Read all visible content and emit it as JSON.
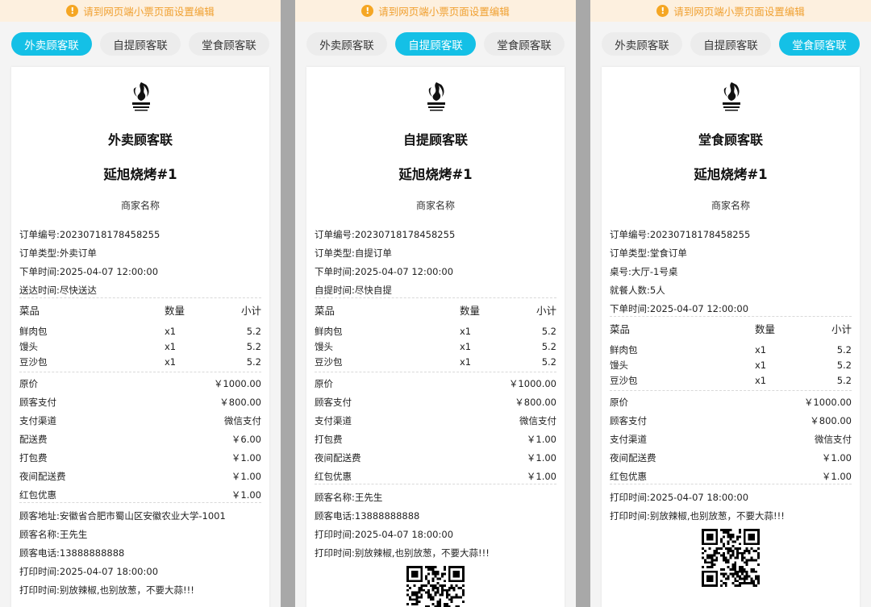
{
  "banner": "请到网页端小票页面设置编辑",
  "tabs": [
    "外卖顾客联",
    "自提顾客联",
    "堂食顾客联"
  ],
  "columns": {
    "item": "菜品",
    "qty": "数量",
    "subtotal": "小计"
  },
  "items": [
    {
      "name": "鲜肉包",
      "qty": "x1",
      "price": "5.2"
    },
    {
      "name": "馒头",
      "qty": "x1",
      "price": "5.2"
    },
    {
      "name": "豆沙包",
      "qty": "x1",
      "price": "5.2"
    }
  ],
  "receipts": [
    {
      "title": "外卖顾客联",
      "store": "延旭烧烤#1",
      "merchant": "商家名称",
      "order_info": [
        "订单编号:20230718178458255",
        "订单类型:外卖订单",
        "下单时间:2025-04-07 12:00:00",
        "送达时间:尽快送达"
      ],
      "fees": [
        {
          "label": "原价",
          "value": "￥1000.00"
        },
        {
          "label": "顾客支付",
          "value": "￥800.00"
        },
        {
          "label": "支付渠道",
          "value": "微信支付"
        },
        {
          "label": "配送费",
          "value": "￥6.00"
        },
        {
          "label": "打包费",
          "value": "￥1.00"
        },
        {
          "label": "夜间配送费",
          "value": "￥1.00"
        },
        {
          "label": "红包优惠",
          "value": "￥1.00"
        }
      ],
      "footer": [
        "顾客地址:安徽省合肥市蜀山区安徽农业大学-1001",
        "顾客名称:王先生",
        "顾客电话:13888888888",
        "打印时间:2025-04-07 18:00:00",
        "打印时间:别放辣椒,也别放葱，不要大蒜!!!"
      ]
    },
    {
      "title": "自提顾客联",
      "store": "延旭烧烤#1",
      "merchant": "商家名称",
      "order_info": [
        "订单编号:20230718178458255",
        "订单类型:自提订单",
        "下单时间:2025-04-07 12:00:00",
        "自提时间:尽快自提"
      ],
      "fees": [
        {
          "label": "原价",
          "value": "￥1000.00"
        },
        {
          "label": "顾客支付",
          "value": "￥800.00"
        },
        {
          "label": "支付渠道",
          "value": "微信支付"
        },
        {
          "label": "打包费",
          "value": "￥1.00"
        },
        {
          "label": "夜间配送费",
          "value": "￥1.00"
        },
        {
          "label": "红包优惠",
          "value": "￥1.00"
        }
      ],
      "footer": [
        "顾客名称:王先生",
        "顾客电话:13888888888",
        "打印时间:2025-04-07 18:00:00",
        "打印时间:别放辣椒,也别放葱，不要大蒜!!!"
      ]
    },
    {
      "title": "堂食顾客联",
      "store": "延旭烧烤#1",
      "merchant": "商家名称",
      "order_info": [
        "订单编号:20230718178458255",
        "订单类型:堂食订单",
        "桌号:大厅-1号桌",
        "就餐人数:5人",
        "下单时间:2025-04-07 12:00:00"
      ],
      "fees": [
        {
          "label": "原价",
          "value": "￥1000.00"
        },
        {
          "label": "顾客支付",
          "value": "￥800.00"
        },
        {
          "label": "支付渠道",
          "value": "微信支付"
        },
        {
          "label": "夜间配送费",
          "value": "￥1.00"
        },
        {
          "label": "红包优惠",
          "value": "￥1.00"
        }
      ],
      "footer": [
        "打印时间:2025-04-07 18:00:00",
        "打印时间:别放辣椒,也别放葱，不要大蒜!!!"
      ]
    }
  ],
  "colors": {
    "accent": "#14c0e6",
    "banner_bg": "#fdf0df",
    "banner_text": "#f0a030",
    "divider": "#a8a8a8"
  }
}
